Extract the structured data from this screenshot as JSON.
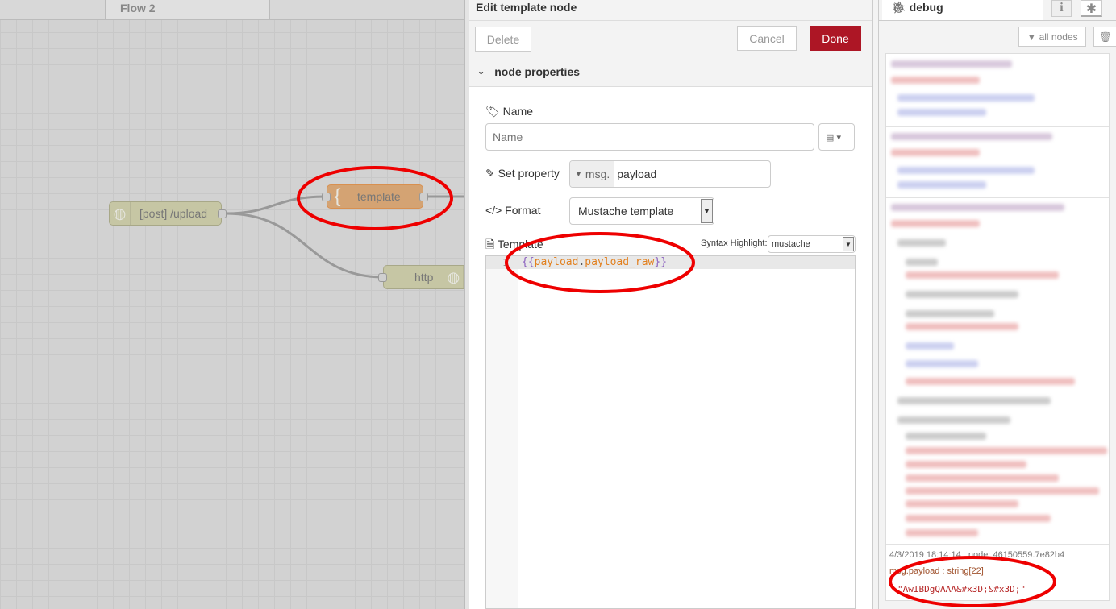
{
  "workspace": {
    "tabs": [
      {
        "label": "Flow 2"
      }
    ],
    "nodes": [
      {
        "label": "[post] /upload",
        "icon": "globe-icon"
      },
      {
        "label": "template",
        "icon": "brace-icon"
      },
      {
        "label": "http",
        "icon": "globe-icon"
      }
    ]
  },
  "editor": {
    "title": "Edit template node",
    "delete_label": "Delete",
    "cancel_label": "Cancel",
    "done_label": "Done",
    "done_color": "#ad1625",
    "section_label": "node properties",
    "name_label": "Name",
    "name_placeholder": "Name",
    "name_value": "",
    "set_property_label": "Set property",
    "property_prefix": "msg.",
    "property_value": "payload",
    "format_label": "Format",
    "format_value": "Mustache template",
    "template_label": "Template",
    "syntax_label": "Syntax Highlight:",
    "syntax_value": "mustache",
    "code": {
      "line_number": "1",
      "open": "{{",
      "part1": "payload",
      "dot": ".",
      "part2": "payload_raw",
      "close": "}}"
    }
  },
  "debug": {
    "tab_label": "debug",
    "filter_label": "all nodes",
    "last_message": {
      "timestamp": "4/3/2019 18:14:14",
      "node": "node: 46150559.7e82b4",
      "topic": "msg.payload : string[22]",
      "value": "\"AwIBDgQAAA&#x3D;&#x3D;\""
    }
  }
}
